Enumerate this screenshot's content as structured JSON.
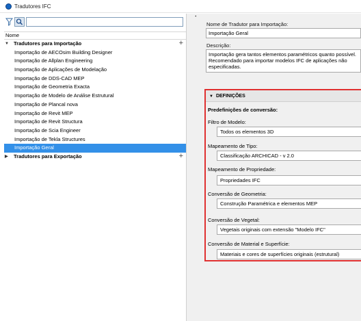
{
  "window": {
    "title": "Tradutores IFC",
    "accent": "#3390e8",
    "highlight": "#e03030"
  },
  "search": {
    "placeholder": "",
    "value": ""
  },
  "list": {
    "column_header": "Nome",
    "import_group": "Tradutores para Importação",
    "import_items": [
      "Importação de AECOsim Building Designer",
      "Importação de Allplan Engineering",
      "Importação de Aplicações de Modelação",
      "Importação de DDS-CAD MEP",
      "Importação de Geometria Exacta",
      "Importação de Modelo de Análise Estrutural",
      "Importação de Plancal nova",
      "Importação de Revit MEP",
      "Importação de Revit Structura",
      "Importação de Scia Engineer",
      "Importação de Tekla Structures",
      "Importação Geral"
    ],
    "selected_index": 11,
    "export_group": "Tradutores para Exportação"
  },
  "details": {
    "name_label": "Nome de Tradutor para Importação:",
    "name_value": "Importação Geral",
    "desc_label": "Descrição:",
    "desc_value": "Importação gera tantos elementos paramétricos quanto possível. Recomendado para importar modelos IFC de aplicações não especificadas."
  },
  "definitions": {
    "header": "DEFINIÇÕES",
    "subheader": "Predefinições de conversão:",
    "model_filter_label": "Filtro de Modelo:",
    "model_filter_value": "Todos os elementos 3D",
    "type_mapping_label": "Mapeamento de Tipo:",
    "type_mapping_value": "Classificação ARCHICAD - v 2.0",
    "property_mapping_label": "Mapeamento de Propriedade:",
    "property_mapping_value": "Propriedades IFC",
    "geometry_label": "Conversão de Geometria:",
    "geometry_value": "Construção Paramétrica e elementos MEP",
    "vegetation_label": "Conversão de Vegetal:",
    "vegetation_value": "Vegetais originais com extensão \"Modelo IFC\"",
    "material_label": "Conversão de Material e Superfície:",
    "material_value": "Materiais e cores de superfícies originais (estrutural)"
  }
}
